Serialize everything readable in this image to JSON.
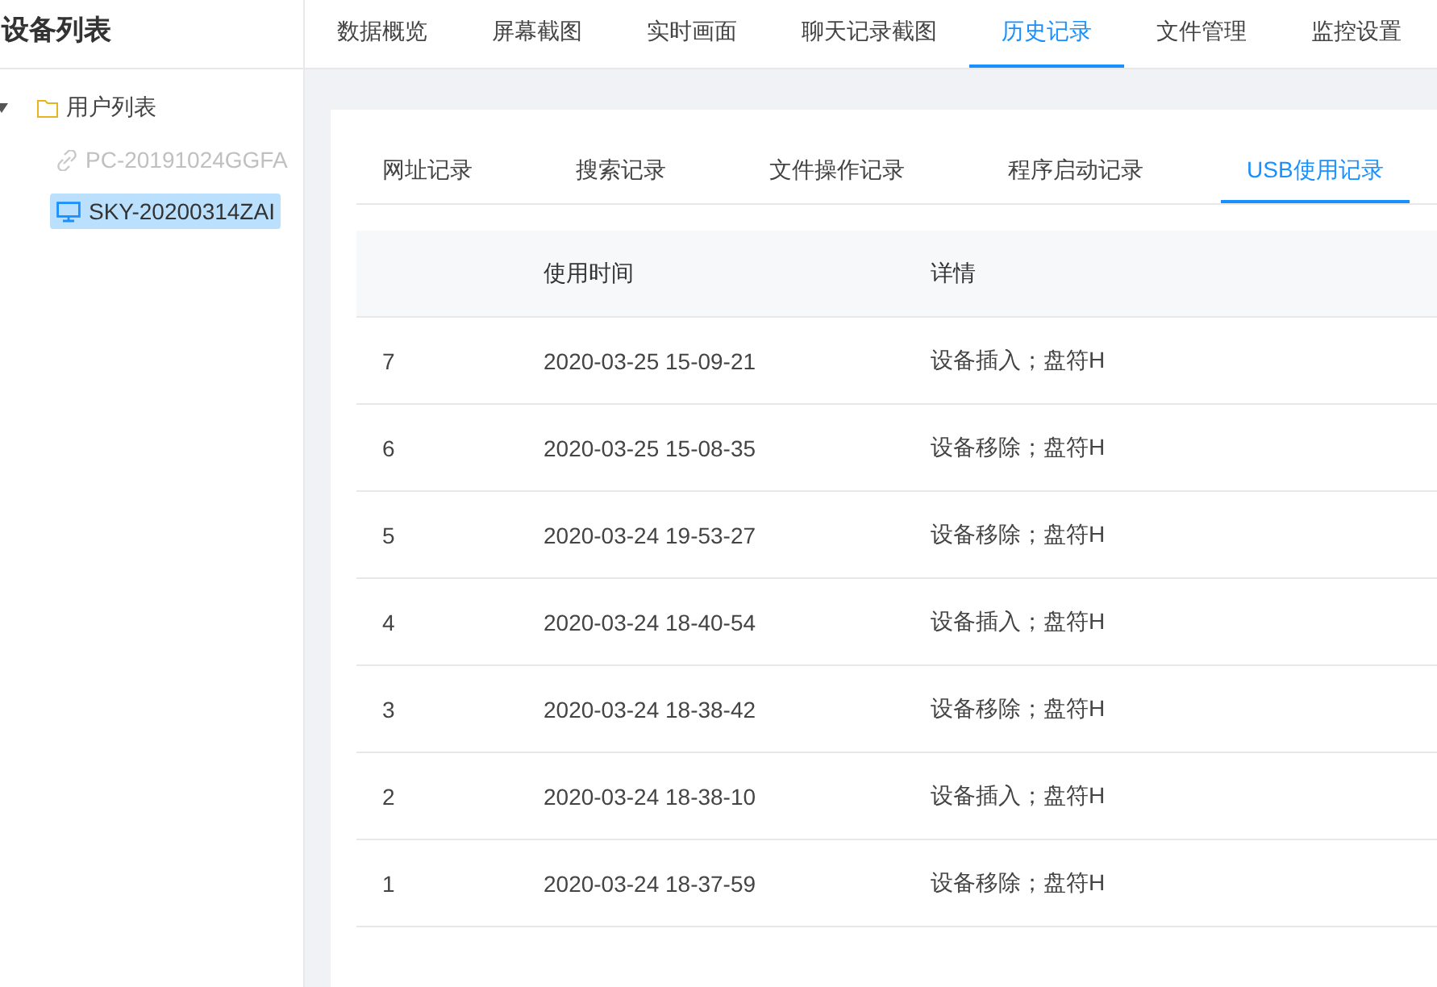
{
  "sidebar": {
    "title": "设备列表",
    "tree": [
      {
        "label": "用户列表",
        "kind": "folder",
        "expanded": true,
        "selected": false,
        "disabled": false,
        "children": [
          {
            "label": "PC-20191024GGFA",
            "kind": "device",
            "selected": false,
            "disabled": true
          },
          {
            "label": "SKY-20200314ZAI",
            "kind": "device",
            "selected": true,
            "disabled": false
          }
        ]
      }
    ]
  },
  "top_tabs": [
    {
      "label": "数据概览",
      "selected": false
    },
    {
      "label": "屏幕截图",
      "selected": false
    },
    {
      "label": "实时画面",
      "selected": false
    },
    {
      "label": "聊天记录截图",
      "selected": false
    },
    {
      "label": "历史记录",
      "selected": true
    },
    {
      "label": "文件管理",
      "selected": false
    },
    {
      "label": "监控设置",
      "selected": false
    }
  ],
  "sub_tabs": [
    {
      "label": "网址记录",
      "selected": false
    },
    {
      "label": "搜索记录",
      "selected": false
    },
    {
      "label": "文件操作记录",
      "selected": false
    },
    {
      "label": "程序启动记录",
      "selected": false
    },
    {
      "label": "USB使用记录",
      "selected": true
    }
  ],
  "table": {
    "columns": [
      "",
      "使用时间",
      "详情"
    ],
    "rows": [
      [
        "7",
        "2020-03-25 15-09-21",
        "设备插入；盘符H"
      ],
      [
        "6",
        "2020-03-25 15-08-35",
        "设备移除；盘符H"
      ],
      [
        "5",
        "2020-03-24 19-53-27",
        "设备移除；盘符H"
      ],
      [
        "4",
        "2020-03-24 18-40-54",
        "设备插入；盘符H"
      ],
      [
        "3",
        "2020-03-24 18-38-42",
        "设备移除；盘符H"
      ],
      [
        "2",
        "2020-03-24 18-38-10",
        "设备插入；盘符H"
      ],
      [
        "1",
        "2020-03-24 18-37-59",
        "设备移除；盘符H"
      ]
    ]
  }
}
